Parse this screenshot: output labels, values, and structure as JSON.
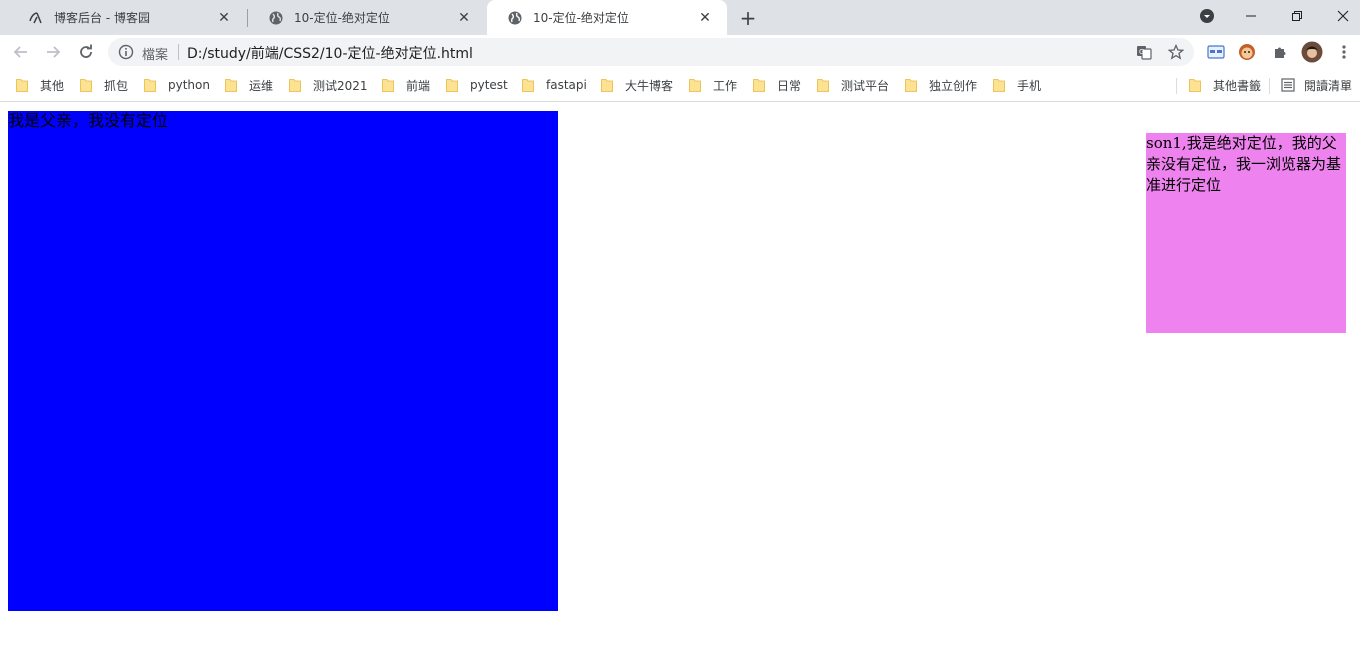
{
  "browser": {
    "tabs": [
      {
        "title": "博客后台 - 博客园",
        "active": false,
        "icon": "cnblogs-icon"
      },
      {
        "title": "10-定位-绝对定位",
        "active": false,
        "icon": "globe-icon"
      },
      {
        "title": "10-定位-绝对定位",
        "active": true,
        "icon": "globe-icon"
      }
    ],
    "new_tab_label": "+",
    "address_bar": {
      "security_label": "檔案",
      "url": "D:/study/前端/CSS2/10-定位-绝对定位.html"
    },
    "bookmarks": [
      {
        "label": "其他"
      },
      {
        "label": "抓包"
      },
      {
        "label": "python"
      },
      {
        "label": "运维"
      },
      {
        "label": "测试2021"
      },
      {
        "label": "前端"
      },
      {
        "label": "pytest"
      },
      {
        "label": "fastapi"
      },
      {
        "label": "大牛博客"
      },
      {
        "label": "工作"
      },
      {
        "label": "日常"
      },
      {
        "label": "测试平台"
      },
      {
        "label": "独立创作"
      },
      {
        "label": "手机"
      }
    ],
    "other_bookmarks_label": "其他書籤",
    "reading_list_label": "閱讀清單"
  },
  "page": {
    "father_text": "我是父亲，我没有定位",
    "son_text": "son1,我是绝对定位，我的父亲没有定位，我一浏览器为基准进行定位",
    "colors": {
      "father_background": "#0000ff",
      "son_background": "#ee82ee"
    }
  }
}
